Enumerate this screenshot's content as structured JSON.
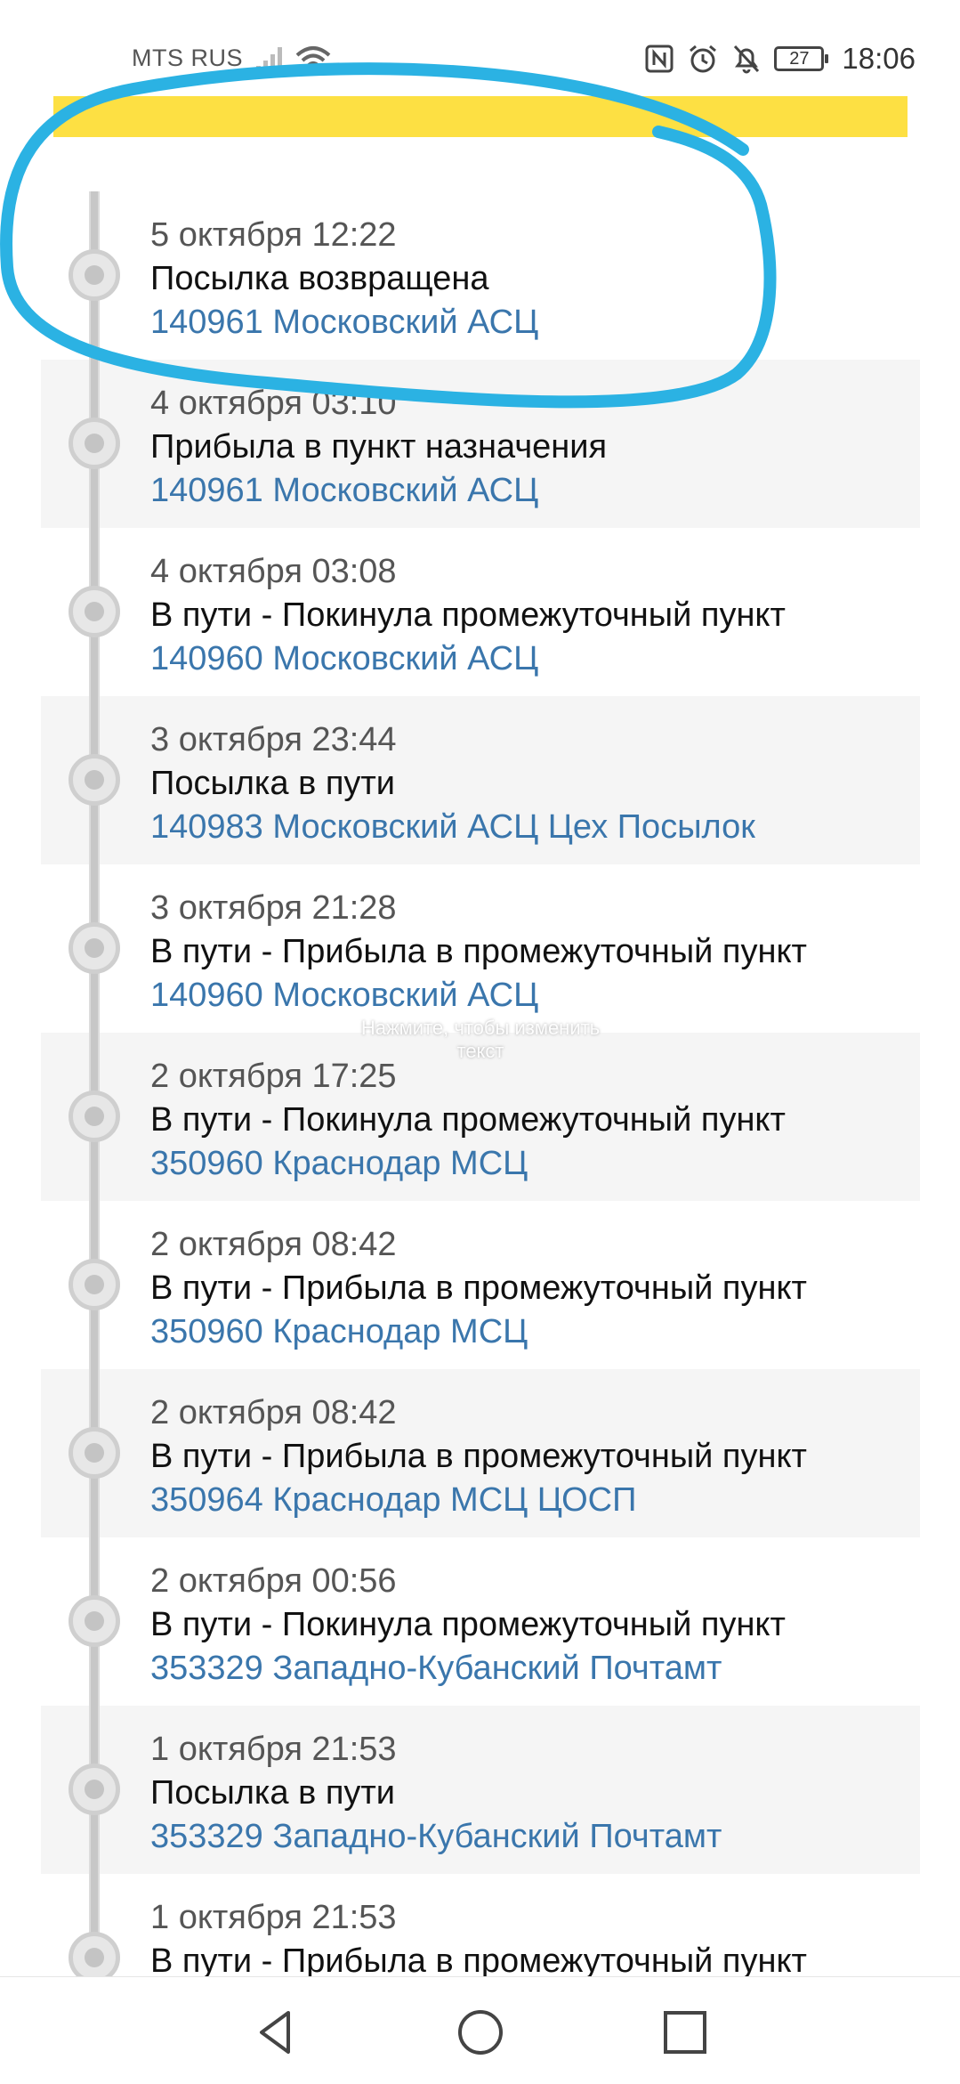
{
  "status_bar": {
    "carrier": "MTS RUS",
    "battery_level": "27",
    "time": "18:06",
    "icons": [
      "signal-icon",
      "wifi-icon",
      "nfc-icon",
      "alarm-icon",
      "notifications-off-icon",
      "battery-icon"
    ]
  },
  "colors": {
    "header_accent": "#fde043",
    "location_text": "#3a76ac",
    "annotation_circle": "#2bb2e3"
  },
  "timeline": {
    "events": [
      {
        "date": "5 октября 12:22",
        "status": "Посылка возвращена",
        "location": "140961 Московский АСЦ"
      },
      {
        "date": "4 октября 03:10",
        "status": "Прибыла в пункт назначения",
        "location": "140961 Московский АСЦ"
      },
      {
        "date": "4 октября 03:08",
        "status": "В пути - Покинула промежуточный пункт",
        "location": "140960 Московский АСЦ"
      },
      {
        "date": "3 октября 23:44",
        "status": "Посылка в пути",
        "location": "140983 Московский АСЦ Цех Посылок"
      },
      {
        "date": "3 октября 21:28",
        "status": "В пути - Прибыла в промежуточный пункт",
        "location": "140960 Московский АСЦ"
      },
      {
        "date": "2 октября 17:25",
        "status": "В пути - Покинула промежуточный пункт",
        "location": "350960 Краснодар МСЦ"
      },
      {
        "date": "2 октября 08:42",
        "status": "В пути - Прибыла в промежуточный пункт",
        "location": "350960 Краснодар МСЦ"
      },
      {
        "date": "2 октября 08:42",
        "status": "В пути - Прибыла в промежуточный пункт",
        "location": "350964 Краснодар МСЦ ЦОСП"
      },
      {
        "date": "2 октября 00:56",
        "status": "В пути - Покинула промежуточный пункт",
        "location": "353329 Западно-Кубанский Почтамт"
      },
      {
        "date": "1 октября 21:53",
        "status": "Посылка в пути",
        "location": "353329 Западно-Кубанский Почтамт"
      },
      {
        "date": "1 октября 21:53",
        "status": "В пути - Прибыла в промежуточный пункт",
        "location": ""
      }
    ]
  },
  "edit_hint": "Нажмите, чтобы изменить текст",
  "nav_bar": {
    "buttons": [
      "back-icon",
      "home-icon",
      "recent-apps-icon"
    ]
  }
}
